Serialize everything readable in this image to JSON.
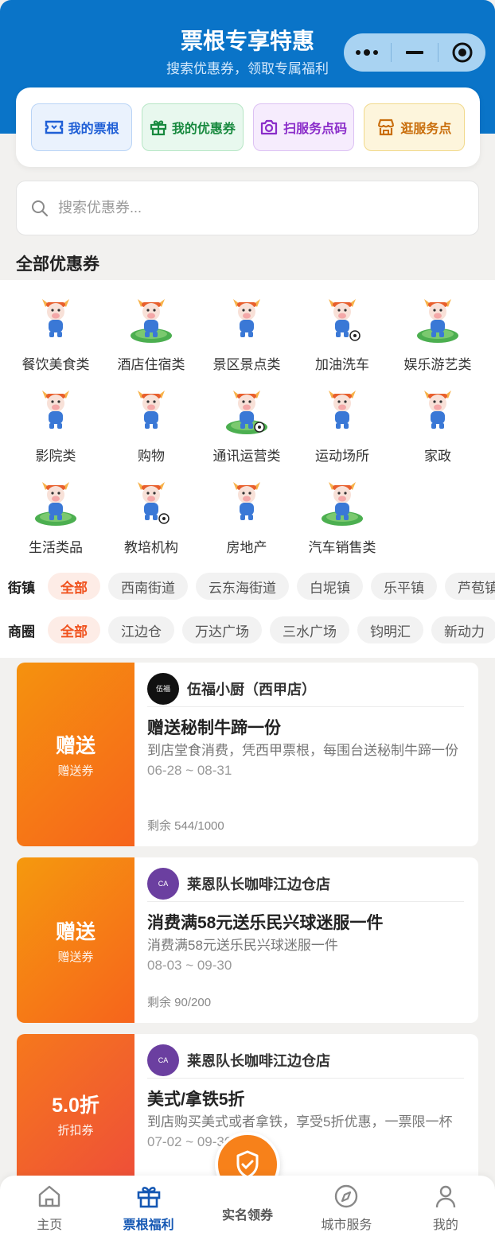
{
  "header": {
    "title": "票根专享特惠",
    "subtitle": "搜索优惠券，领取专属福利"
  },
  "quick_actions": [
    {
      "label": "我的票根",
      "icon": "ticket-icon"
    },
    {
      "label": "我的优惠券",
      "icon": "gift-icon"
    },
    {
      "label": "扫服务点码",
      "icon": "camera-icon"
    },
    {
      "label": "逛服务点",
      "icon": "store-icon"
    }
  ],
  "search": {
    "placeholder": "搜索优惠券..."
  },
  "section_title": "全部优惠券",
  "categories": [
    "餐饮美食类",
    "酒店住宿类",
    "景区景点类",
    "加油洗车",
    "娱乐游艺类",
    "影院类",
    "购物",
    "通讯运营类",
    "运动场所",
    "家政",
    "生活类品",
    "教培机构",
    "房地产",
    "汽车销售类"
  ],
  "filters": {
    "street": {
      "label": "街镇",
      "chips": [
        "全部",
        "西南街道",
        "云东海街道",
        "白坭镇",
        "乐平镇",
        "芦苞镇"
      ]
    },
    "area": {
      "label": "商圈",
      "chips": [
        "全部",
        "江边仓",
        "万达广场",
        "三水广场",
        "钧明汇",
        "新动力"
      ]
    }
  },
  "coupons": [
    {
      "badge": "赠送",
      "badge_sub": "赠送券",
      "store": "伍福小厨（西甲店）",
      "logo_text": "伍福小厨",
      "title": "赠送秘制牛蹄一份",
      "desc": "到店堂食消费，凭西甲票根，每围台送秘制牛蹄一份",
      "date": "06-28 ~ 08-31",
      "remaining": "剩余 544/1000",
      "color_from": "#f5920e",
      "color_to": "#f6641c",
      "logo_color": "#111111"
    },
    {
      "badge": "赠送",
      "badge_sub": "赠送券",
      "store": "莱恩队长咖啡江边仓店",
      "logo_text": "CAPTAIN LION",
      "title": "消费满58元送乐民兴球迷服一件",
      "desc": "消费满58元送乐民兴球迷服一件",
      "date": "08-03 ~ 09-30",
      "remaining": "剩余 90/200",
      "color_from": "#f5990e",
      "color_to": "#f6641c",
      "logo_color": "#6b3fa0"
    },
    {
      "badge": "5.0折",
      "badge_sub": "折扣券",
      "store": "莱恩队长咖啡江边仓店",
      "logo_text": "CAPTAIN LION",
      "title": "美式/拿铁5折",
      "desc": "到店购买美式或者拿铁，享受5折优惠，一票限一杯",
      "date": "07-02 ~ 09-30",
      "remaining": "",
      "color_from": "#f6781c",
      "color_to": "#ee4d3a",
      "logo_color": "#6b3fa0"
    }
  ],
  "fab": {
    "label": "实名领券",
    "icon": "shield-check-icon"
  },
  "tabbar": [
    {
      "label": "主页",
      "icon": "home-icon",
      "active": false
    },
    {
      "label": "票根福利",
      "icon": "gift-icon",
      "active": true
    },
    {
      "label": "城市服务",
      "icon": "compass-icon",
      "active": false
    },
    {
      "label": "我的",
      "icon": "user-icon",
      "active": false
    }
  ],
  "colors": {
    "primary": "#0a74c8",
    "accent": "#f0521e",
    "tab_active": "#1457b3"
  }
}
